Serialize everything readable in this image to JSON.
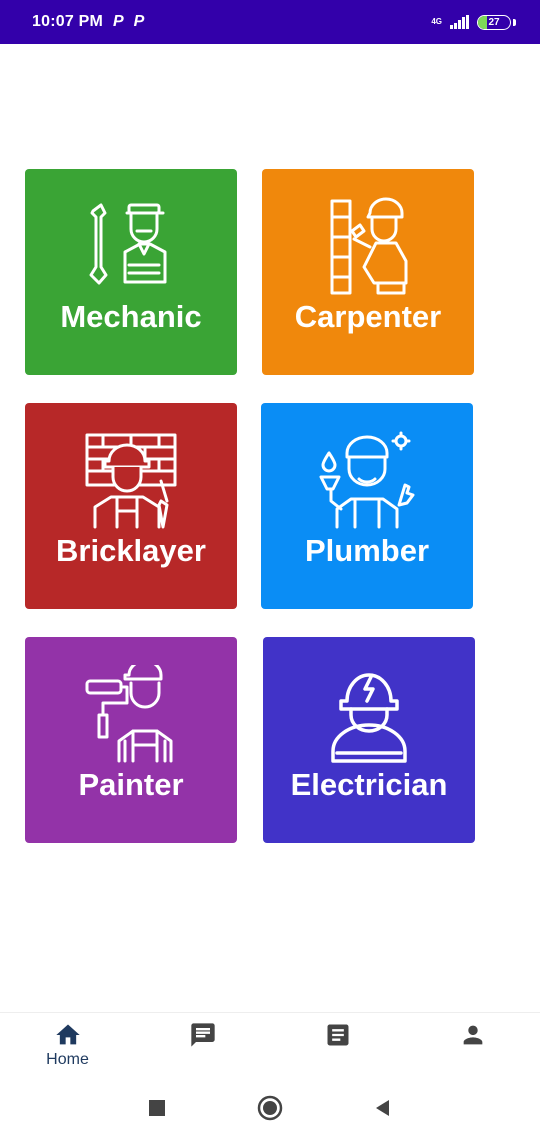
{
  "status_bar": {
    "time": "10:07 PM",
    "notif_icons": [
      "P",
      "P"
    ],
    "network": "4G",
    "battery": "27",
    "background": "#3300aa"
  },
  "categories": [
    {
      "label": "Mechanic",
      "color": "#3aa435",
      "icon": "mechanic-icon"
    },
    {
      "label": "Carpenter",
      "color": "#f0880c",
      "icon": "carpenter-icon"
    },
    {
      "label": "Bricklayer",
      "color": "#b72828",
      "icon": "bricklayer-icon"
    },
    {
      "label": "Plumber",
      "color": "#0a8df5",
      "icon": "plumber-icon"
    },
    {
      "label": "Painter",
      "color": "#9333a8",
      "icon": "painter-icon"
    },
    {
      "label": "Electrician",
      "color": "#4133c8",
      "icon": "electrician-icon"
    }
  ],
  "bottom_nav": {
    "items": [
      {
        "label": "Home",
        "icon": "home-icon"
      },
      {
        "label": "",
        "icon": "chat-icon"
      },
      {
        "label": "",
        "icon": "document-icon"
      },
      {
        "label": "",
        "icon": "person-icon"
      }
    ],
    "active_color": "#1f3a5f",
    "inactive_color": "#444444"
  }
}
